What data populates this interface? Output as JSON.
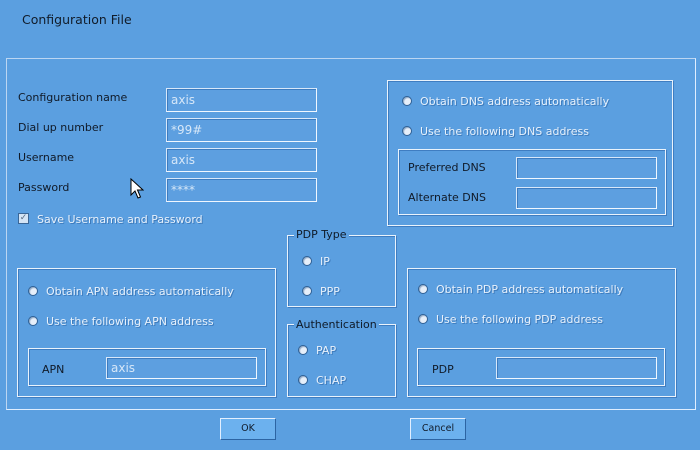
{
  "window": {
    "title": "Configuration File"
  },
  "profile": {
    "name_label": "Configuration name",
    "name_value": "axis",
    "dial_label": "Dial up number",
    "dial_value": "*99#",
    "username_label": "Username",
    "username_value": "axis",
    "password_label": "Password",
    "password_value": "****",
    "save_label": "Save Username and Password",
    "save_checked": true
  },
  "dns": {
    "auto_label": "Obtain DNS address automatically",
    "manual_label": "Use the following DNS address",
    "preferred_label": "Preferred DNS",
    "preferred_value": "",
    "alternate_label": "Alternate DNS",
    "alternate_value": ""
  },
  "pdp_type": {
    "legend": "PDP Type",
    "ip_label": "IP",
    "ppp_label": "PPP"
  },
  "authentication": {
    "legend": "Authentication",
    "pap_label": "PAP",
    "chap_label": "CHAP"
  },
  "apn": {
    "auto_label": "Obtain APN address automatically",
    "manual_label": "Use the following APN address",
    "apn_label": "APN",
    "apn_value": "axis"
  },
  "pdp": {
    "auto_label": "Obtain PDP address automatically",
    "manual_label": "Use the following PDP address",
    "pdp_label": "PDP",
    "pdp_value": ""
  },
  "buttons": {
    "ok_label": "OK",
    "cancel_label": "Cancel"
  },
  "colors": {
    "background": "#5b9fe0",
    "field_text": "#d6e7f8",
    "button": "#6cb1ee"
  },
  "icons": {
    "pointer": "mouse-pointer-icon",
    "check": "checkmark-icon"
  }
}
